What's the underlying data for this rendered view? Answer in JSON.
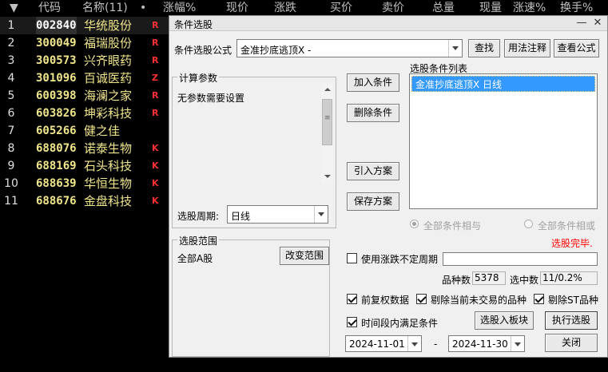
{
  "table": {
    "sort_arrow": "▼",
    "headers": [
      "代码",
      "名称(11)",
      "•",
      "涨幅%",
      "现价",
      "涨跌",
      "买价",
      "卖价",
      "总量",
      "现量",
      "涨速%",
      "换手%"
    ],
    "rows": [
      {
        "idx": "1",
        "code": "002840",
        "name": "华统股份",
        "flag": "R",
        "flag_color": "#ff3030"
      },
      {
        "idx": "2",
        "code": "300049",
        "name": "福瑞股份",
        "flag": "R",
        "flag_color": "#ff3030"
      },
      {
        "idx": "3",
        "code": "300573",
        "name": "兴齐眼药",
        "flag": "R",
        "flag_color": "#ff3030"
      },
      {
        "idx": "4",
        "code": "301096",
        "name": "百诚医药",
        "flag": "Z",
        "flag_color": "#ff3030"
      },
      {
        "idx": "5",
        "code": "600398",
        "name": "海澜之家",
        "flag": "R",
        "flag_color": "#ff3030"
      },
      {
        "idx": "6",
        "code": "603826",
        "name": "坤彩科技",
        "flag": "R",
        "flag_color": "#ff3030"
      },
      {
        "idx": "7",
        "code": "605266",
        "name": "健之佳",
        "flag": "",
        "flag_color": "#ff3030"
      },
      {
        "idx": "8",
        "code": "688076",
        "name": "诺泰生物",
        "flag": "K",
        "flag_color": "#ff3030"
      },
      {
        "idx": "9",
        "code": "688169",
        "name": "石头科技",
        "flag": "K",
        "flag_color": "#ff3030"
      },
      {
        "idx": "10",
        "code": "688639",
        "name": "华恒生物",
        "flag": "K",
        "flag_color": "#ff3030"
      },
      {
        "idx": "11",
        "code": "688676",
        "name": "金盘科技",
        "flag": "K",
        "flag_color": "#ff3030"
      }
    ]
  },
  "dialog": {
    "title": "条件选股",
    "min_icon": "—",
    "close_icon": "✕",
    "formula_label": "条件选股公式",
    "formula_value": "金准抄底逃顶X -",
    "find_button": "查找",
    "usage_button": "用法注释",
    "view_formula_button": "查看公式",
    "params_group": "计算参数",
    "params_text": "无参数需要设置",
    "period_label": "选股周期:",
    "period_value": "日线",
    "add_condition_button": "加入条件",
    "delete_condition_button": "删除条件",
    "import_plan_button": "引入方案",
    "save_plan_button": "保存方案",
    "condition_list_label": "选股条件列表",
    "condition_items": [
      "金准抄底逃顶X  日线"
    ],
    "radio_and": "全部条件相与",
    "radio_or": "全部条件相或",
    "status_text": "选股完毕.",
    "status_color": "#ff0000",
    "range_group": "选股范围",
    "range_value": "全部A股",
    "change_range_button": "改变范围",
    "use_period_label": "使用涨跌不定周期",
    "total_label": "品种数",
    "total_value": "5378",
    "selected_label": "选中数",
    "selected_value": "11/0.2%",
    "chk_forward_adjust": "前复权数据",
    "chk_exclude_untraded": "剔除当前未交易的品种",
    "chk_exclude_st": "剔除ST品种",
    "chk_time_range": "时间段内满足条件",
    "to_block_button": "选股入板块",
    "run_button": "执行选股",
    "date_from": "2024-11-01",
    "date_sep": "-",
    "date_to": "2024-11-30",
    "close_button": "关闭"
  }
}
